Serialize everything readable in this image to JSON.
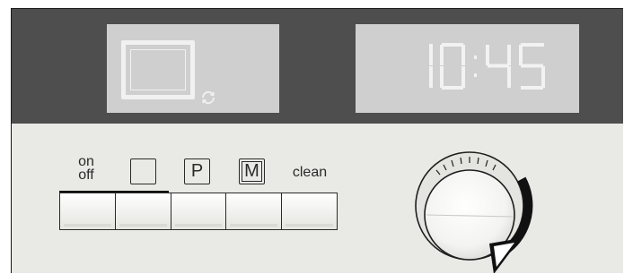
{
  "display": {
    "clock_text": "10:45",
    "mode_icon": "oven-cavity-icon",
    "rotation_icon": "rotate-arrows-icon"
  },
  "buttons": [
    {
      "id": "on-off",
      "label_line1": "on",
      "label_line2": "off"
    },
    {
      "id": "blank",
      "label": ""
    },
    {
      "id": "program",
      "label": "P"
    },
    {
      "id": "memory",
      "label": "M"
    },
    {
      "id": "clean",
      "label": "clean"
    }
  ],
  "knob": {
    "icon": "rotary-knob-icon",
    "arrow_icon": "clockwise-arrow-icon"
  },
  "colors": {
    "display_band": "#4e4e4e",
    "lcd": "#cfcfcf",
    "segment": "#f2f2f2",
    "panel": "#e9e9e6"
  }
}
